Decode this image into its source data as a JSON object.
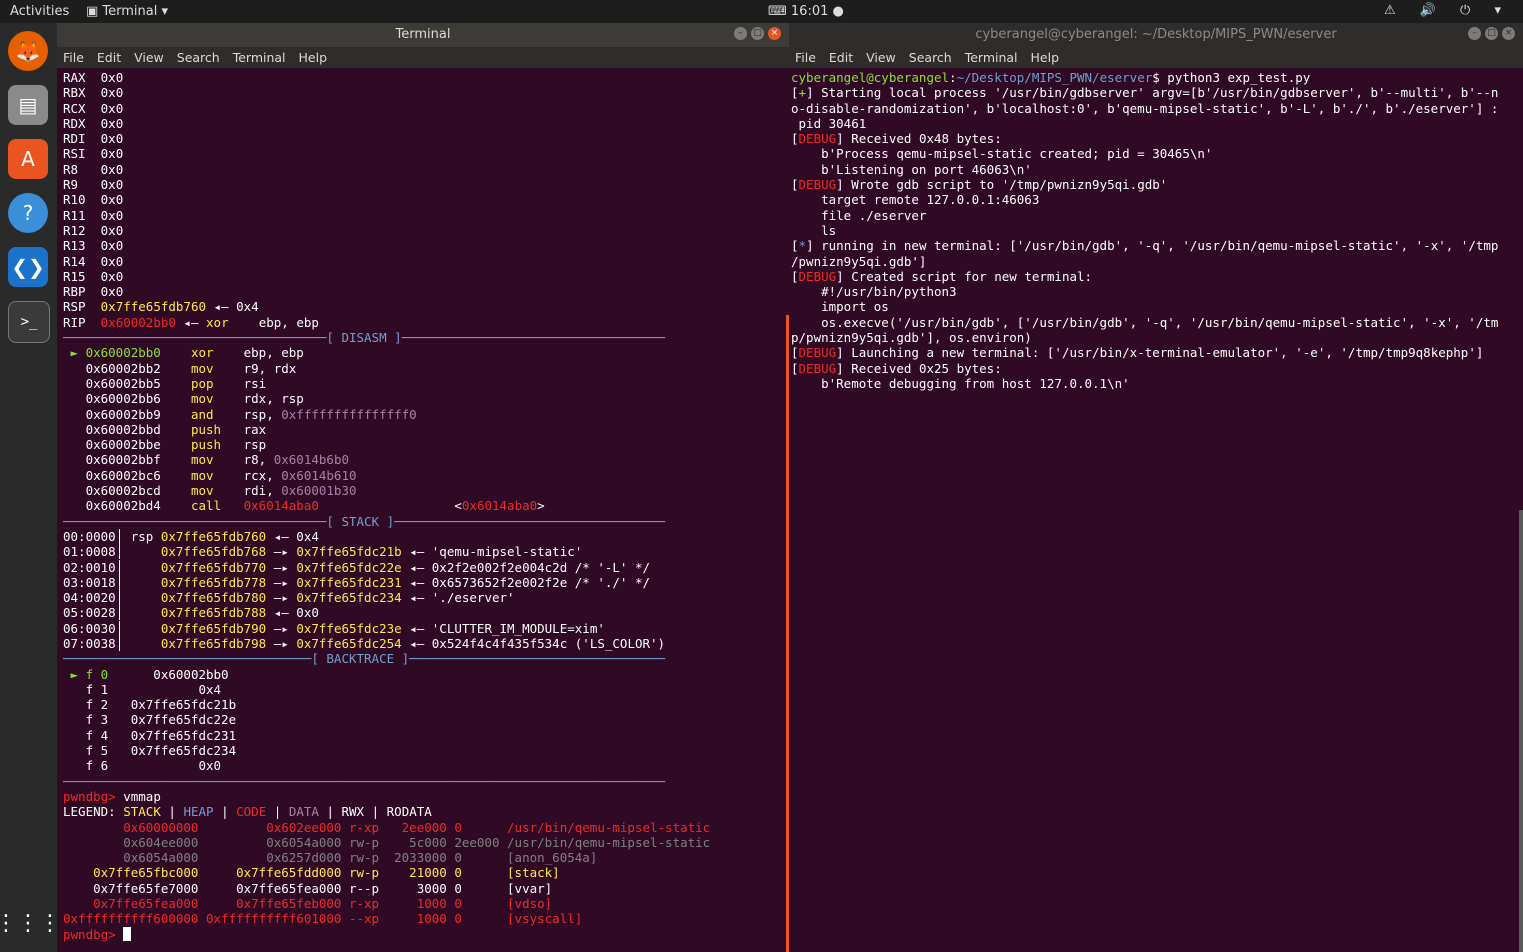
{
  "topbar": {
    "activities": "Activities",
    "app": "Terminal",
    "clock": "16:01",
    "tray": "⚠ 🔊 ⏻ ▾"
  },
  "dock": {
    "items": [
      "firefox-icon",
      "files-icon",
      "software-icon",
      "help-icon",
      "vscode-icon",
      "terminal-icon",
      "apps-grid-icon"
    ]
  },
  "left_window": {
    "title": "Terminal",
    "menu": [
      "File",
      "Edit",
      "View",
      "Search",
      "Terminal",
      "Help"
    ]
  },
  "right_window": {
    "title": "cyberangel@cyberangel: ~/Desktop/MIPS_PWN/eserver",
    "menu": [
      "File",
      "Edit",
      "View",
      "Search",
      "Terminal",
      "Help"
    ]
  },
  "left_lines": [
    [
      [
        "w",
        "RAX  "
      ],
      [
        "w",
        "0x0"
      ]
    ],
    [
      [
        "w",
        "RBX  "
      ],
      [
        "w",
        "0x0"
      ]
    ],
    [
      [
        "w",
        "RCX  "
      ],
      [
        "w",
        "0x0"
      ]
    ],
    [
      [
        "w",
        "RDX  "
      ],
      [
        "w",
        "0x0"
      ]
    ],
    [
      [
        "w",
        "RDI  "
      ],
      [
        "w",
        "0x0"
      ]
    ],
    [
      [
        "w",
        "RSI  "
      ],
      [
        "w",
        "0x0"
      ]
    ],
    [
      [
        "w",
        "R8   "
      ],
      [
        "w",
        "0x0"
      ]
    ],
    [
      [
        "w",
        "R9   "
      ],
      [
        "w",
        "0x0"
      ]
    ],
    [
      [
        "w",
        "R10  "
      ],
      [
        "w",
        "0x0"
      ]
    ],
    [
      [
        "w",
        "R11  "
      ],
      [
        "w",
        "0x0"
      ]
    ],
    [
      [
        "w",
        "R12  "
      ],
      [
        "w",
        "0x0"
      ]
    ],
    [
      [
        "w",
        "R13  "
      ],
      [
        "w",
        "0x0"
      ]
    ],
    [
      [
        "w",
        "R14  "
      ],
      [
        "w",
        "0x0"
      ]
    ],
    [
      [
        "w",
        "R15  "
      ],
      [
        "w",
        "0x0"
      ]
    ],
    [
      [
        "w",
        "RBP  "
      ],
      [
        "w",
        "0x0"
      ]
    ],
    [
      [
        "w",
        "RSP  "
      ],
      [
        "y",
        "0x7ffe65fdb760"
      ],
      [
        "w",
        " ◂— 0x4"
      ]
    ],
    [
      [
        "w",
        "RIP  "
      ],
      [
        "r",
        "0x60002bb0"
      ],
      [
        "w",
        " ◂— "
      ],
      [
        "y",
        "xor"
      ],
      [
        "w",
        "    ebp, ebp"
      ]
    ],
    [
      [
        "b",
        "───────────────────────────────────[ DISASM ]───────────────────────────────────"
      ]
    ],
    [
      [
        "g",
        " ► 0x60002bb0    "
      ],
      [
        "y",
        "xor"
      ],
      [
        "w",
        "    ebp, ebp"
      ]
    ],
    [
      [
        "w",
        "   0x60002bb2    "
      ],
      [
        "y",
        "mov"
      ],
      [
        "w",
        "    r9, rdx"
      ]
    ],
    [
      [
        "w",
        "   0x60002bb5    "
      ],
      [
        "y",
        "pop"
      ],
      [
        "w",
        "    rsi"
      ]
    ],
    [
      [
        "w",
        "   0x60002bb6    "
      ],
      [
        "y",
        "mov"
      ],
      [
        "w",
        "    rdx, rsp"
      ]
    ],
    [
      [
        "w",
        "   0x60002bb9    "
      ],
      [
        "y",
        "and"
      ],
      [
        "w",
        "    rsp, "
      ],
      [
        "m",
        "0xfffffffffffffff0"
      ]
    ],
    [
      [
        "w",
        "   0x60002bbd    "
      ],
      [
        "y",
        "push"
      ],
      [
        "w",
        "   rax"
      ]
    ],
    [
      [
        "w",
        "   0x60002bbe    "
      ],
      [
        "y",
        "push"
      ],
      [
        "w",
        "   rsp"
      ]
    ],
    [
      [
        "w",
        "   0x60002bbf    "
      ],
      [
        "y",
        "mov"
      ],
      [
        "w",
        "    r8, "
      ],
      [
        "m",
        "0x6014b6b0"
      ]
    ],
    [
      [
        "w",
        "   0x60002bc6    "
      ],
      [
        "y",
        "mov"
      ],
      [
        "w",
        "    rcx, "
      ],
      [
        "m",
        "0x6014b610"
      ]
    ],
    [
      [
        "w",
        "   0x60002bcd    "
      ],
      [
        "y",
        "mov"
      ],
      [
        "w",
        "    rdi, "
      ],
      [
        "m",
        "0x60001b30"
      ]
    ],
    [
      [
        "w",
        "   0x60002bd4    "
      ],
      [
        "y",
        "call"
      ],
      [
        "w",
        "   "
      ],
      [
        "r",
        "0x6014aba0"
      ],
      [
        "w",
        "                  <"
      ],
      [
        "r",
        "0x6014aba0"
      ],
      [
        "w",
        ">"
      ]
    ],
    [
      [
        "b",
        "───────────────────────────────────[ STACK ]────────────────────────────────────"
      ]
    ],
    [
      [
        "w",
        "00:0000│ rsp "
      ],
      [
        "y",
        "0x7ffe65fdb760"
      ],
      [
        "w",
        " ◂— 0x4"
      ]
    ],
    [
      [
        "w",
        "01:0008│     "
      ],
      [
        "y",
        "0x7ffe65fdb768"
      ],
      [
        "w",
        " —▸ "
      ],
      [
        "y",
        "0x7ffe65fdc21b"
      ],
      [
        "w",
        " ◂— 'qemu-mipsel-static'"
      ]
    ],
    [
      [
        "w",
        "02:0010│     "
      ],
      [
        "y",
        "0x7ffe65fdb770"
      ],
      [
        "w",
        " —▸ "
      ],
      [
        "y",
        "0x7ffe65fdc22e"
      ],
      [
        "w",
        " ◂— 0x2f2e002f2e004c2d /* '-L' */"
      ]
    ],
    [
      [
        "w",
        "03:0018│     "
      ],
      [
        "y",
        "0x7ffe65fdb778"
      ],
      [
        "w",
        " —▸ "
      ],
      [
        "y",
        "0x7ffe65fdc231"
      ],
      [
        "w",
        " ◂— 0x6573652f2e002f2e /* './' */"
      ]
    ],
    [
      [
        "w",
        "04:0020│     "
      ],
      [
        "y",
        "0x7ffe65fdb780"
      ],
      [
        "w",
        " —▸ "
      ],
      [
        "y",
        "0x7ffe65fdc234"
      ],
      [
        "w",
        " ◂— './eserver'"
      ]
    ],
    [
      [
        "w",
        "05:0028│     "
      ],
      [
        "y",
        "0x7ffe65fdb788"
      ],
      [
        "w",
        " ◂— 0x0"
      ]
    ],
    [
      [
        "w",
        "06:0030│     "
      ],
      [
        "y",
        "0x7ffe65fdb790"
      ],
      [
        "w",
        " —▸ "
      ],
      [
        "y",
        "0x7ffe65fdc23e"
      ],
      [
        "w",
        " ◂— 'CLUTTER_IM_MODULE=xim'"
      ]
    ],
    [
      [
        "w",
        "07:0038│     "
      ],
      [
        "y",
        "0x7ffe65fdb798"
      ],
      [
        "w",
        " —▸ "
      ],
      [
        "y",
        "0x7ffe65fdc254"
      ],
      [
        "w",
        " ◂— 0x524f4c4f435f534c ('LS_COLOR')"
      ]
    ],
    [
      [
        "b",
        "─────────────────────────────────[ BACKTRACE ]──────────────────────────────────"
      ]
    ],
    [
      [
        "g",
        " ► f 0"
      ],
      [
        "w",
        "      0x60002bb0"
      ]
    ],
    [
      [
        "w",
        "   f 1            0x4"
      ]
    ],
    [
      [
        "w",
        "   f 2   0x7ffe65fdc21b"
      ]
    ],
    [
      [
        "w",
        "   f 3   0x7ffe65fdc22e"
      ]
    ],
    [
      [
        "w",
        "   f 4   0x7ffe65fdc231"
      ]
    ],
    [
      [
        "w",
        "   f 5   0x7ffe65fdc234"
      ]
    ],
    [
      [
        "w",
        "   f 6            0x0"
      ]
    ],
    [
      [
        "b",
        "────────────────────────────────────────────────────────────────────────────────"
      ]
    ],
    [
      [
        "r",
        "pwndbg> "
      ],
      [
        "w",
        "vmmap"
      ]
    ],
    [
      [
        "w",
        "LEGEND: "
      ],
      [
        "y",
        "STACK"
      ],
      [
        "w",
        " | "
      ],
      [
        "b",
        "HEAP"
      ],
      [
        "w",
        " | "
      ],
      [
        "r",
        "CODE"
      ],
      [
        "w",
        " | "
      ],
      [
        "m",
        "DATA"
      ],
      [
        "w",
        " | "
      ],
      [
        "w",
        "RWX"
      ],
      [
        "w",
        " | RODATA"
      ]
    ],
    [
      [
        "r",
        "        0x60000000         0x602ee000 r-xp   2ee000 0      /usr/bin/qemu-mipsel-static"
      ]
    ],
    [
      [
        "gr",
        "        0x604ee000         0x6054a000 rw-p    5c000 2ee000 /usr/bin/qemu-mipsel-static"
      ]
    ],
    [
      [
        "gr",
        "        0x6054a000         0x6257d000 rw-p  2033000 0      [anon_6054a]"
      ]
    ],
    [
      [
        "y",
        "    0x7ffe65fbc000     0x7ffe65fdd000 rw-p    21000 0      [stack]"
      ]
    ],
    [
      [
        "w",
        "    0x7ffe65fe7000     0x7ffe65fea000 r--p     3000 0      [vvar]"
      ]
    ],
    [
      [
        "r",
        "    0x7ffe65fea000     0x7ffe65feb000 r-xp     1000 0      [vdso]"
      ]
    ],
    [
      [
        "r",
        "0xffffffffff600000 0xffffffffff601000 --xp     1000 0      [vsyscall]"
      ]
    ],
    [
      [
        "r",
        "pwndbg> "
      ]
    ]
  ],
  "right_lines": [
    [
      [
        "g",
        "cyberangel@cyberangel"
      ],
      [
        "w",
        ":"
      ],
      [
        "b",
        "~/Desktop/MIPS_PWN/eserver"
      ],
      [
        "w",
        "$ python3 exp_test.py"
      ]
    ],
    [
      [
        "w",
        "["
      ],
      [
        "g",
        "+"
      ],
      [
        "w",
        "] Starting local process '/usr/bin/gdbserver' argv=[b'/usr/bin/gdbserver', b'--multi', b'--n"
      ]
    ],
    [
      [
        "w",
        "o-disable-randomization', b'localhost:0', b'qemu-mipsel-static', b'-L', b'./', b'./eserver'] :"
      ]
    ],
    [
      [
        "w",
        " pid 30461"
      ]
    ],
    [
      [
        "w",
        "["
      ],
      [
        "r",
        "DEBUG"
      ],
      [
        "w",
        "] Received 0x48 bytes:"
      ]
    ],
    [
      [
        "w",
        "    b'Process qemu-mipsel-static created; pid = 30465\\n'"
      ]
    ],
    [
      [
        "w",
        "    b'Listening on port 46063\\n'"
      ]
    ],
    [
      [
        "w",
        "["
      ],
      [
        "r",
        "DEBUG"
      ],
      [
        "w",
        "] Wrote gdb script to '/tmp/pwnizn9y5qi.gdb'"
      ]
    ],
    [
      [
        "w",
        "    target remote 127.0.0.1:46063"
      ]
    ],
    [
      [
        "w",
        "    file ./eserver"
      ]
    ],
    [
      [
        "w",
        "    ls"
      ]
    ],
    [
      [
        "w",
        "["
      ],
      [
        "b",
        "*"
      ],
      [
        "w",
        "] running in new terminal: ['/usr/bin/gdb', '-q', '/usr/bin/qemu-mipsel-static', '-x', '/tmp"
      ]
    ],
    [
      [
        "w",
        "/pwnizn9y5qi.gdb']"
      ]
    ],
    [
      [
        "w",
        "["
      ],
      [
        "r",
        "DEBUG"
      ],
      [
        "w",
        "] Created script for new terminal:"
      ]
    ],
    [
      [
        "w",
        "    #!/usr/bin/python3"
      ]
    ],
    [
      [
        "w",
        "    import os"
      ]
    ],
    [
      [
        "w",
        "    os.execve('/usr/bin/gdb', ['/usr/bin/gdb', '-q', '/usr/bin/qemu-mipsel-static', '-x', '/tm"
      ]
    ],
    [
      [
        "w",
        "p/pwnizn9y5qi.gdb'], os.environ)"
      ]
    ],
    [
      [
        "w",
        "["
      ],
      [
        "r",
        "DEBUG"
      ],
      [
        "w",
        "] Launching a new terminal: ['/usr/bin/x-terminal-emulator', '-e', '/tmp/tmp9q8kephp']"
      ]
    ],
    [
      [
        "w",
        "["
      ],
      [
        "r",
        "DEBUG"
      ],
      [
        "w",
        "] Received 0x25 bytes:"
      ]
    ],
    [
      [
        "w",
        "    b'Remote debugging from host 127.0.0.1\\n'"
      ]
    ]
  ]
}
